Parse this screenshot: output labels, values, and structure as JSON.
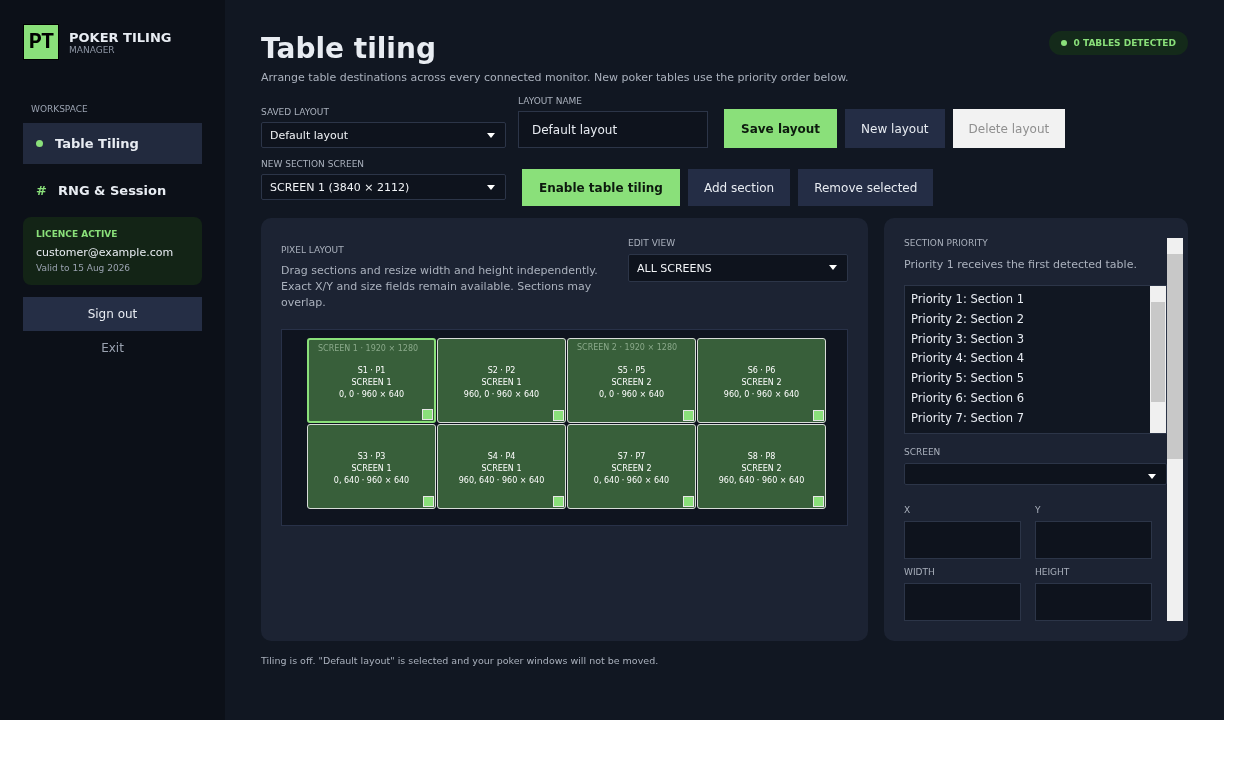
{
  "brand": {
    "logo": "PT",
    "title": "POKER TILING",
    "subtitle": "MANAGER"
  },
  "sidebar": {
    "section_label": "WORKSPACE",
    "items": [
      {
        "label": "Table Tiling",
        "kind": "dot",
        "selected": true
      },
      {
        "label": "RNG & Session",
        "kind": "glyph",
        "icon": "#",
        "selected": false
      }
    ],
    "licence": {
      "status": "LICENCE ACTIVE",
      "email": "customer@example.com",
      "valid": "Valid to 15 Aug 2026"
    },
    "sign_out": "Sign out",
    "exit": "Exit"
  },
  "header": {
    "title": "Table tiling",
    "subtitle": "Arrange table destinations across every connected monitor. New poker tables use the priority order below.",
    "badge": "0 TABLES DETECTED"
  },
  "saved_layout": {
    "label": "SAVED LAYOUT",
    "value": "Default layout"
  },
  "layout_name": {
    "label": "LAYOUT NAME",
    "value": "Default layout"
  },
  "layout_buttons": [
    {
      "label": "Save layout",
      "kind": "primary",
      "disabled": false
    },
    {
      "label": "New layout",
      "kind": "secondary",
      "disabled": false
    },
    {
      "label": "Delete layout",
      "kind": "secondary",
      "disabled": true
    }
  ],
  "new_section_screen": {
    "label": "NEW SECTION SCREEN",
    "value": "SCREEN 1  (3840 × 2112)"
  },
  "section_buttons": [
    {
      "label": "Enable table tiling",
      "kind": "primary",
      "disabled": false
    },
    {
      "label": "Add section",
      "kind": "secondary",
      "disabled": false
    },
    {
      "label": "Remove selected",
      "kind": "secondary",
      "disabled": false
    }
  ],
  "pixel_layout": {
    "title": "PIXEL LAYOUT",
    "description": "Drag sections and resize width and height independently. Exact X/Y and size fields remain available. Sections may overlap.",
    "edit_view": {
      "label": "EDIT VIEW",
      "value": "ALL SCREENS"
    },
    "sections": [
      {
        "name": "S1 · P1",
        "screen": "SCREEN 1",
        "geometry": "0, 0 · 960 × 640",
        "caption": "SCREEN 1  ·  1920 × 1280",
        "selected": true
      },
      {
        "name": "S2 · P2",
        "screen": "SCREEN 1",
        "geometry": "960, 0 · 960 × 640",
        "selected": false
      },
      {
        "name": "S5 · P5",
        "screen": "SCREEN 2",
        "geometry": "0, 0 · 960 × 640",
        "caption": "SCREEN 2  ·  1920 × 1280",
        "selected": false
      },
      {
        "name": "S6 · P6",
        "screen": "SCREEN 2",
        "geometry": "960, 0 · 960 × 640",
        "selected": false
      },
      {
        "name": "S3 · P3",
        "screen": "SCREEN 1",
        "geometry": "0, 640 · 960 × 640",
        "selected": false
      },
      {
        "name": "S4 · P4",
        "screen": "SCREEN 1",
        "geometry": "960, 640 · 960 × 640",
        "selected": false
      },
      {
        "name": "S7 · P7",
        "screen": "SCREEN 2",
        "geometry": "0, 640 · 960 × 640",
        "selected": false
      },
      {
        "name": "S8 · P8",
        "screen": "SCREEN 2",
        "geometry": "960, 640 · 960 × 640",
        "selected": false
      }
    ]
  },
  "section_priority": {
    "title": "SECTION PRIORITY",
    "description": "Priority 1 receives the first detected table.",
    "items": [
      "Priority 1: Section 1",
      "Priority 2: Section 2",
      "Priority 3: Section 3",
      "Priority 4: Section 4",
      "Priority 5: Section 5",
      "Priority 6: Section 6",
      "Priority 7: Section 7"
    ],
    "screen_label": "SCREEN",
    "fields": [
      "X",
      "Y",
      "WIDTH",
      "HEIGHT"
    ]
  },
  "status": "Tiling is off. \"Default layout\" is selected and your poker windows will not be moved."
}
